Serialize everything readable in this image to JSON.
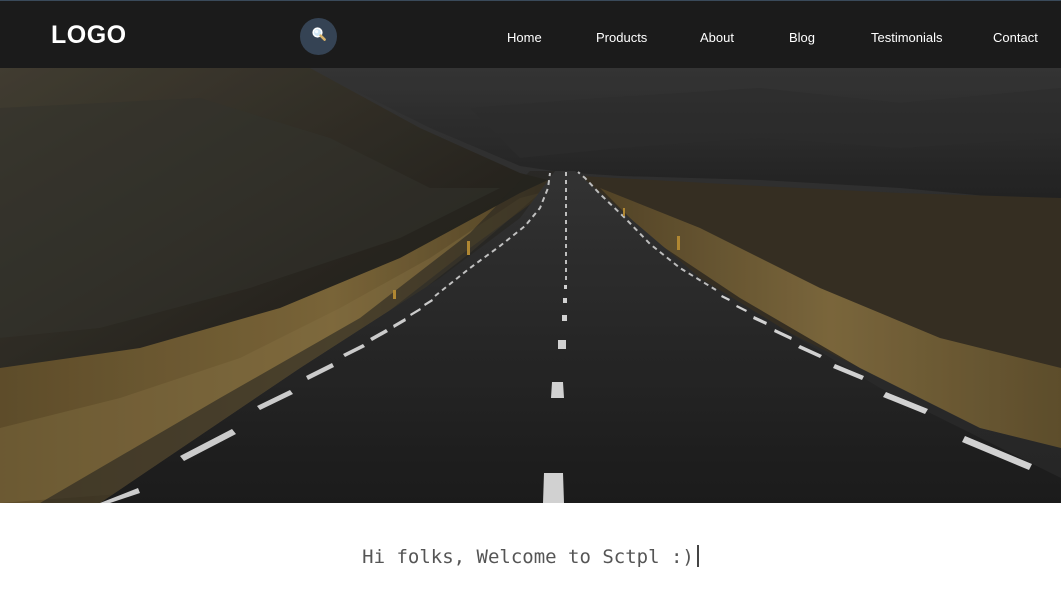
{
  "header": {
    "logo": "LOGO",
    "search_icon": "search-icon",
    "nav": [
      {
        "label": "Home"
      },
      {
        "label": "Products"
      },
      {
        "label": "About"
      },
      {
        "label": "Blog"
      },
      {
        "label": "Testimonials"
      },
      {
        "label": "Contact"
      }
    ]
  },
  "hero": {
    "image": "highway-road-landscape"
  },
  "welcome": {
    "text": "Hi folks, Welcome to Sctpl :)"
  },
  "colors": {
    "navbar_bg": "#1b1b1b",
    "search_bg": "#354354",
    "nav_text": "#ffffff",
    "welcome_text": "#555555"
  }
}
